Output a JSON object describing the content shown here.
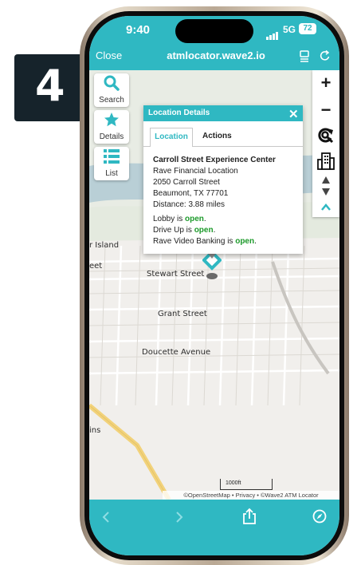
{
  "step": {
    "number": "4"
  },
  "status_bar": {
    "time": "9:40",
    "network": "5G",
    "battery": "72"
  },
  "browser": {
    "close_label": "Close",
    "url": "atmlocator.wave2.io"
  },
  "map_controls": {
    "search_label": "Search",
    "details_label": "Details",
    "list_label": "List",
    "zoom_in": "+",
    "zoom_out": "−"
  },
  "map_labels": {
    "island": "r Island",
    "street_partial": "eet",
    "stewart": "Stewart Street",
    "grant": "Grant Street",
    "doucette": "Doucette Avenue",
    "ins": "ins"
  },
  "popup": {
    "title": "Location Details",
    "close": "✕",
    "tabs": [
      "Location",
      "Actions"
    ],
    "name": "Carroll Street Experience Center",
    "org": "Rave Financial Location",
    "address1": "2050 Carroll Street",
    "address2": "Beaumont, TX 77701",
    "distance": "Distance: 3.88 miles",
    "lobby_prefix": "Lobby is ",
    "lobby_status": "open",
    "drive_prefix": "Drive Up is ",
    "drive_status": "open",
    "video_prefix": "Rave Video Banking is ",
    "video_status": "open",
    "period": "."
  },
  "map_footer": {
    "scale": "1000ft",
    "attribution": "©OpenStreetMap • Privacy • ©Wave2 ATM Locator"
  },
  "colors": {
    "accent": "#2fb8c2",
    "open_green": "#1c9a2a",
    "badge": "#16232b",
    "marker": "#2fb8c2"
  }
}
